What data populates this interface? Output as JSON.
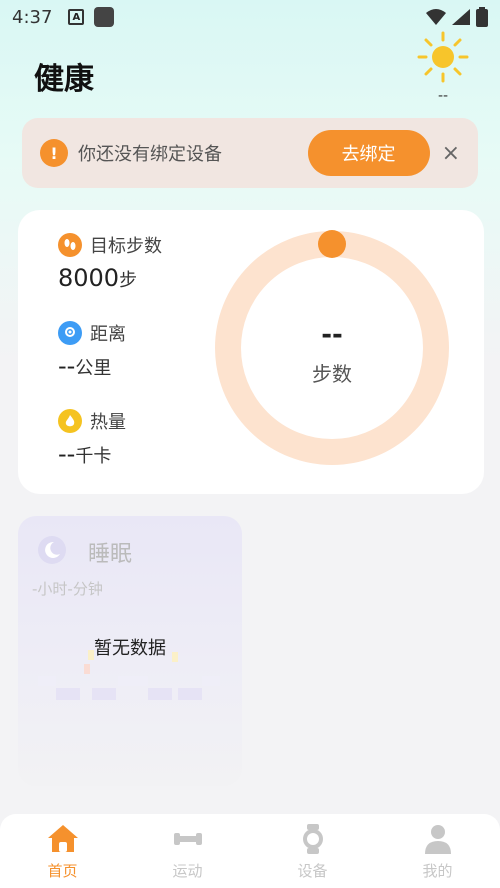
{
  "status_bar": {
    "time": "4:37",
    "a_icon_label": "A"
  },
  "header": {
    "title": "健康"
  },
  "weather": {
    "temp": "--"
  },
  "bind_banner": {
    "message": "你还没有绑定设备",
    "button_label": "去绑定",
    "close_label": "×",
    "warn_symbol": "!"
  },
  "steps": {
    "metrics": [
      {
        "label": "目标步数",
        "value": "8000",
        "unit": "步"
      },
      {
        "label": "距离",
        "value": "--",
        "unit": "公里"
      },
      {
        "label": "热量",
        "value": "--",
        "unit": "千卡"
      }
    ],
    "ring_value": "--",
    "ring_label": "步数"
  },
  "sleep": {
    "title": "睡眠",
    "duration": "-小时-分钟",
    "no_data": "暂无数据"
  },
  "nav": [
    {
      "label": "首页",
      "icon": "home-icon",
      "active": true
    },
    {
      "label": "运动",
      "icon": "dumbbell-icon",
      "active": false
    },
    {
      "label": "设备",
      "icon": "watch-icon",
      "active": false
    },
    {
      "label": "我的",
      "icon": "person-icon",
      "active": false
    }
  ],
  "colors": {
    "accent": "#f5912d",
    "ring": "#fde3cf",
    "nav_inactive": "#c7c7c7"
  }
}
